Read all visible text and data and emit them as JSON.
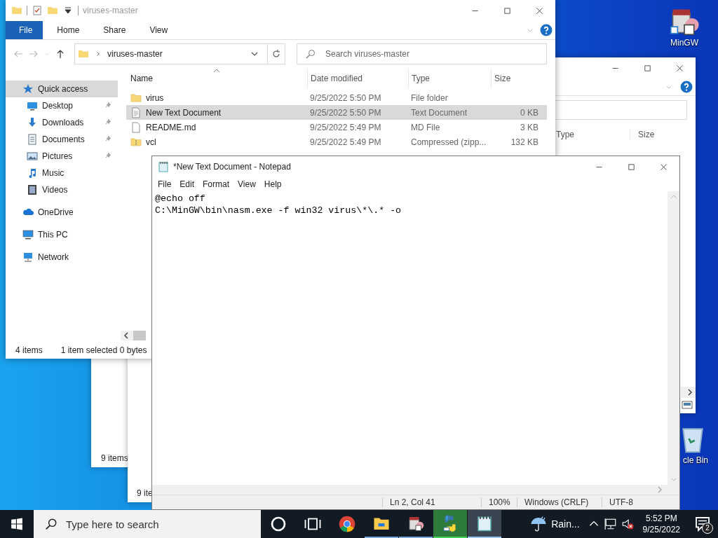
{
  "desktop_icons": [
    {
      "kind": "installer",
      "label": "MinGW"
    },
    {
      "kind": "recycle",
      "label": "cle Bin"
    }
  ],
  "background_windows": [
    {
      "status": "9 items"
    },
    {
      "status": "9 ite"
    }
  ],
  "right_window": {
    "columns": [
      "Type",
      "Size"
    ]
  },
  "explorer": {
    "title": "viruses-master",
    "ribbon_tabs": [
      {
        "label": "File",
        "kind": "backstage"
      },
      {
        "label": "Home",
        "kind": "tab"
      },
      {
        "label": "Share",
        "kind": "tab"
      },
      {
        "label": "View",
        "kind": "tab"
      }
    ],
    "address": "viruses-master",
    "search": {
      "placeholder": "Search viruses-master"
    },
    "nav_items": [
      {
        "kind": "star",
        "label": "Quick access",
        "selected": true,
        "children": [
          {
            "kind": "desktop",
            "label": "Desktop",
            "pinned": true,
            "selected": false
          },
          {
            "kind": "downloads",
            "label": "Downloads",
            "pinned": true,
            "selected": false
          },
          {
            "kind": "documents",
            "label": "Documents",
            "pinned": true,
            "selected": false
          },
          {
            "kind": "pictures",
            "label": "Pictures",
            "pinned": true,
            "selected": false
          },
          {
            "kind": "music",
            "label": "Music",
            "pinned": false,
            "selected": false
          },
          {
            "kind": "videos",
            "label": "Videos",
            "pinned": false,
            "selected": false
          }
        ]
      },
      {
        "kind": "cloud",
        "label": "OneDrive",
        "selected": false
      },
      {
        "kind": "pc",
        "label": "This PC",
        "selected": false
      },
      {
        "kind": "network",
        "label": "Network",
        "selected": false
      }
    ],
    "columns": [
      "Name",
      "Date modified",
      "Type",
      "Size"
    ],
    "rows": [
      {
        "kind": "folder",
        "name": "virus",
        "date": "9/25/2022 5:50 PM",
        "type": "File folder",
        "size": "",
        "selected": false
      },
      {
        "kind": "text",
        "name": "New Text Document",
        "date": "9/25/2022 5:50 PM",
        "type": "Text Document",
        "size": "0 KB",
        "selected": true
      },
      {
        "kind": "file",
        "name": "README.md",
        "date": "9/25/2022 5:49 PM",
        "type": "MD File",
        "size": "3 KB",
        "selected": false
      },
      {
        "kind": "zip",
        "name": "vcl",
        "date": "9/25/2022 5:49 PM",
        "type": "Compressed (zipp...",
        "size": "132 KB",
        "selected": false
      }
    ],
    "status_bar": {
      "count": "4 items",
      "selection": "1 item selected  0 bytes"
    }
  },
  "notepad": {
    "title": "*New Text Document - Notepad",
    "menu": [
      "File",
      "Edit",
      "Format",
      "View",
      "Help"
    ],
    "lines": [
      "@echo off",
      "C:\\MinGW\\bin\\nasm.exe -f win32 virus\\*\\.* -o"
    ],
    "status": [
      "Ln 2, Col 41",
      "100%",
      "Windows (CRLF)",
      "UTF-8"
    ]
  },
  "taskbar": {
    "search_placeholder": "Type here to search",
    "apps": [
      {
        "kind": "cortana",
        "running": false,
        "flashing": false,
        "active": false
      },
      {
        "kind": "taskview",
        "running": false,
        "flashing": false,
        "active": false
      },
      {
        "kind": "chrome",
        "running": false,
        "flashing": false,
        "active": false
      },
      {
        "kind": "explorer",
        "running": true,
        "flashing": false,
        "active": false
      },
      {
        "kind": "mingw",
        "running": true,
        "flashing": false,
        "active": false
      },
      {
        "kind": "python",
        "running": true,
        "flashing": true,
        "active": false
      },
      {
        "kind": "notepad",
        "running": true,
        "flashing": false,
        "active": true
      }
    ],
    "weather": "Rain...",
    "time": "5:52 PM",
    "date": "9/25/2022",
    "notifications": "2"
  }
}
